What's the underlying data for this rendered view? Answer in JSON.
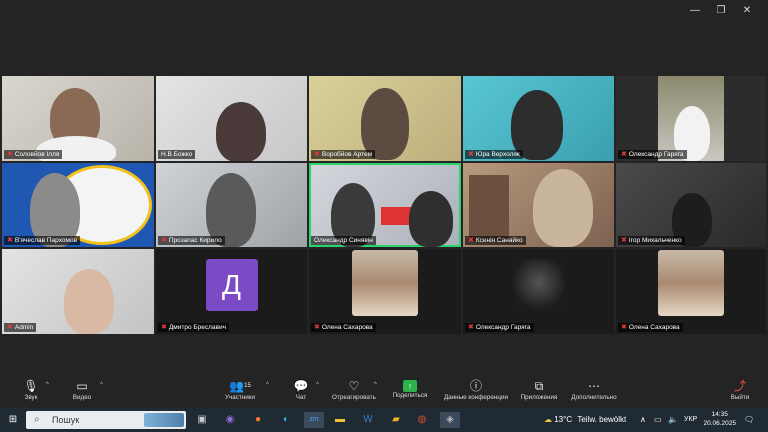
{
  "window_controls": {
    "minimize": "—",
    "maximize": "❐",
    "close": "✕"
  },
  "participants": [
    {
      "name": "Соловйов Ілля",
      "muted": true
    },
    {
      "name": "Н.В.Божко",
      "muted": false
    },
    {
      "name": "Воробйов Артем",
      "muted": true
    },
    {
      "name": "Юра Верхоляк",
      "muted": true
    },
    {
      "name": "Олександр Гаряга",
      "muted": true
    },
    {
      "name": "В'ячеслав Пархомов",
      "muted": true
    },
    {
      "name": "Прозапас Кирило",
      "muted": true
    },
    {
      "name": "Олександр Синявін",
      "muted": false
    },
    {
      "name": "Ксенія Санайко",
      "muted": true
    },
    {
      "name": "Ігор Михальченко",
      "muted": true
    },
    {
      "name": "Admin",
      "muted": true
    },
    {
      "name": "Дмитро Бреславич",
      "muted": true,
      "avatar_letter": "Д"
    },
    {
      "name": "Олена Сахарова",
      "muted": true
    },
    {
      "name": "Олександр Гаряга",
      "muted": true
    },
    {
      "name": "Олена Сахарова",
      "muted": true
    }
  ],
  "toolbar": {
    "audio": "Звук",
    "video": "Видео",
    "participants": "Участники",
    "participants_count": "15",
    "chat": "Чат",
    "react": "Отреагировать",
    "share": "Поделиться",
    "info": "Данные конференции",
    "apps": "Приложения",
    "more": "Дополнительно",
    "exit": "Выйти"
  },
  "taskbar": {
    "search_placeholder": "Пошук",
    "weather_temp": "13°C",
    "weather_text": "Teilw. bewölkt",
    "language": "УКР",
    "time": "14:35",
    "date": "20.06.2025"
  },
  "colors": {
    "active_speaker": "#2bd36b",
    "muted": "#e03a3a",
    "share": "#2bb24c",
    "avatar_bg": "#7b4bc6"
  }
}
